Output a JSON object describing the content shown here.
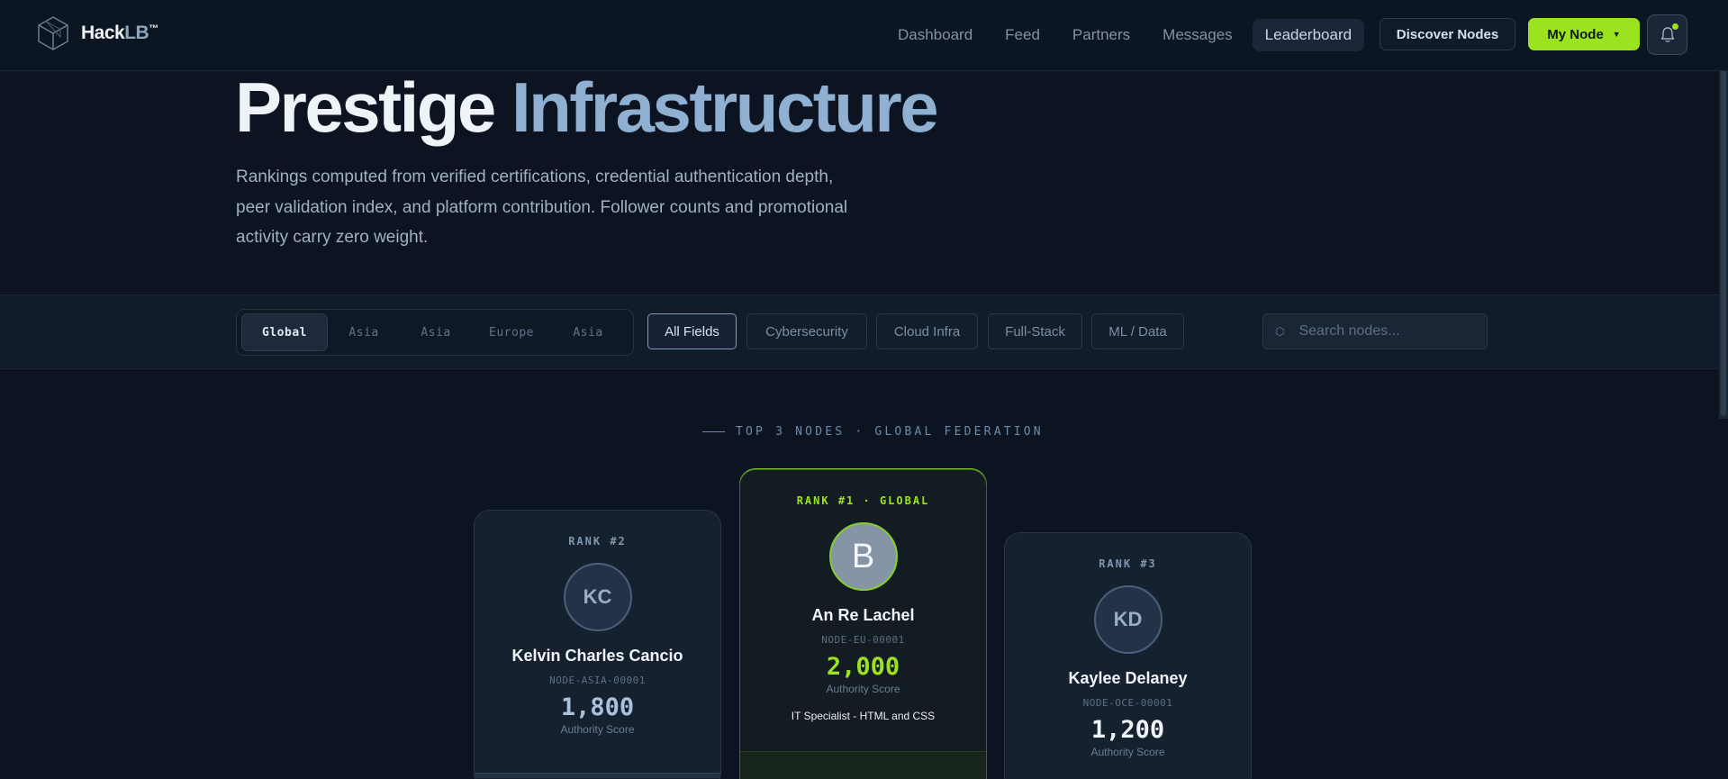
{
  "brand": {
    "name_main": "Hack",
    "name_accent": "LB",
    "trademark": "™"
  },
  "nav": {
    "items": [
      {
        "label": "Dashboard"
      },
      {
        "label": "Feed"
      },
      {
        "label": "Partners"
      },
      {
        "label": "Messages"
      },
      {
        "label": "Leaderboard",
        "active": true
      }
    ],
    "discover_label": "Discover Nodes",
    "mynode_label": "My Node"
  },
  "hero": {
    "title_word1": "Prestige",
    "title_word2": "Infrastructure",
    "description": "Rankings computed from verified certifications, credential authentication depth, peer validation index, and platform contribution. Follower counts and promotional activity carry zero weight."
  },
  "filters": {
    "regions": [
      {
        "label": "Global",
        "active": true
      },
      {
        "label": "Asia"
      },
      {
        "label": "Asia"
      },
      {
        "label": "Europe"
      },
      {
        "label": "Asia"
      }
    ],
    "fields": [
      {
        "label": "All Fields",
        "active": true
      },
      {
        "label": "Cybersecurity"
      },
      {
        "label": "Cloud Infra"
      },
      {
        "label": "Full-Stack"
      },
      {
        "label": "ML / Data"
      }
    ],
    "search_placeholder": "Search nodes..."
  },
  "podium": {
    "heading": "TOP 3 NODES · GLOBAL FEDERATION",
    "cards": [
      {
        "rank_label": "RANK #2",
        "initials": "KC",
        "name": "Kelvin Charles Cancio",
        "node_id": "NODE-ASIA-00001",
        "score": "1,800",
        "score_label": "Authority Score"
      },
      {
        "rank_label": "RANK #1 · GLOBAL",
        "initials": "B",
        "name": "An Re Lachel",
        "node_id": "NODE-EU-00001",
        "score": "2,000",
        "score_label": "Authority Score",
        "specialty": "IT Specialist - HTML and CSS"
      },
      {
        "rank_label": "RANK #3",
        "initials": "KD",
        "name": "Kaylee Delaney",
        "node_id": "NODE-OCE-00001",
        "score": "1,200",
        "score_label": "Authority Score"
      }
    ]
  },
  "colors": {
    "accent": "#9be21f",
    "background": "#0c1421",
    "title_accent": "#8fb0d0"
  },
  "icons": {
    "logo": "hexagon-cube-icon",
    "bell": "bell-icon",
    "search": "hexagon-search-icon",
    "dropdown": "caret-down-icon"
  }
}
